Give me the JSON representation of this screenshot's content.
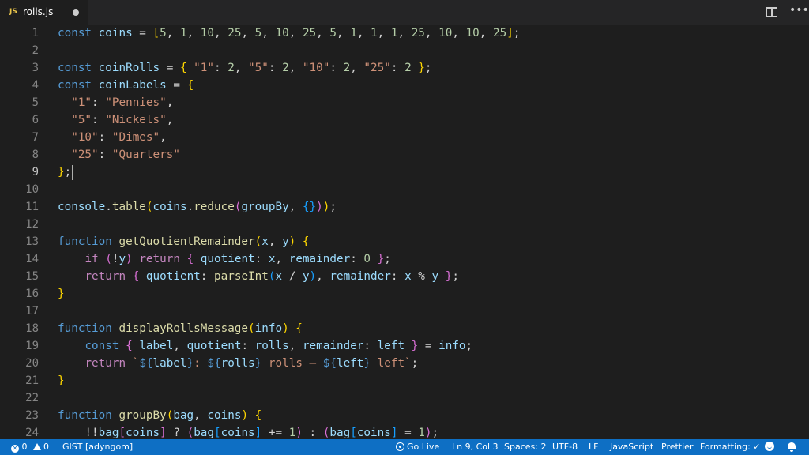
{
  "tab": {
    "badge": "JS",
    "name": "rolls.js",
    "unsaved": true
  },
  "editor": {
    "active_line": 9,
    "lines": [
      {
        "n": "1",
        "tokens": [
          [
            "kw",
            "const "
          ],
          [
            "var",
            "coins"
          ],
          [
            "p",
            " = "
          ],
          [
            "b1",
            "["
          ],
          [
            "num",
            "5"
          ],
          [
            "p",
            ", "
          ],
          [
            "num",
            "1"
          ],
          [
            "p",
            ", "
          ],
          [
            "num",
            "10"
          ],
          [
            "p",
            ", "
          ],
          [
            "num",
            "25"
          ],
          [
            "p",
            ", "
          ],
          [
            "num",
            "5"
          ],
          [
            "p",
            ", "
          ],
          [
            "num",
            "10"
          ],
          [
            "p",
            ", "
          ],
          [
            "num",
            "25"
          ],
          [
            "p",
            ", "
          ],
          [
            "num",
            "5"
          ],
          [
            "p",
            ", "
          ],
          [
            "num",
            "1"
          ],
          [
            "p",
            ", "
          ],
          [
            "num",
            "1"
          ],
          [
            "p",
            ", "
          ],
          [
            "num",
            "1"
          ],
          [
            "p",
            ", "
          ],
          [
            "num",
            "25"
          ],
          [
            "p",
            ", "
          ],
          [
            "num",
            "10"
          ],
          [
            "p",
            ", "
          ],
          [
            "num",
            "10"
          ],
          [
            "p",
            ", "
          ],
          [
            "num",
            "25"
          ],
          [
            "b1",
            "]"
          ],
          [
            "p",
            ";"
          ]
        ]
      },
      {
        "n": "2",
        "tokens": []
      },
      {
        "n": "3",
        "tokens": [
          [
            "kw",
            "const "
          ],
          [
            "var",
            "coinRolls"
          ],
          [
            "p",
            " = "
          ],
          [
            "b1",
            "{ "
          ],
          [
            "str",
            "\"1\""
          ],
          [
            "p",
            ": "
          ],
          [
            "num",
            "2"
          ],
          [
            "p",
            ", "
          ],
          [
            "str",
            "\"5\""
          ],
          [
            "p",
            ": "
          ],
          [
            "num",
            "2"
          ],
          [
            "p",
            ", "
          ],
          [
            "str",
            "\"10\""
          ],
          [
            "p",
            ": "
          ],
          [
            "num",
            "2"
          ],
          [
            "p",
            ", "
          ],
          [
            "str",
            "\"25\""
          ],
          [
            "p",
            ": "
          ],
          [
            "num",
            "2"
          ],
          [
            "b1",
            " }"
          ],
          [
            "p",
            ";"
          ]
        ]
      },
      {
        "n": "4",
        "tokens": [
          [
            "kw",
            "const "
          ],
          [
            "var",
            "coinLabels"
          ],
          [
            "p",
            " = "
          ],
          [
            "b1",
            "{"
          ]
        ]
      },
      {
        "n": "5",
        "tokens": [
          [
            "p",
            "  "
          ],
          [
            "str",
            "\"1\""
          ],
          [
            "p",
            ": "
          ],
          [
            "str",
            "\"Pennies\""
          ],
          [
            "p",
            ","
          ]
        ]
      },
      {
        "n": "6",
        "tokens": [
          [
            "p",
            "  "
          ],
          [
            "str",
            "\"5\""
          ],
          [
            "p",
            ": "
          ],
          [
            "str",
            "\"Nickels\""
          ],
          [
            "p",
            ","
          ]
        ]
      },
      {
        "n": "7",
        "tokens": [
          [
            "p",
            "  "
          ],
          [
            "str",
            "\"10\""
          ],
          [
            "p",
            ": "
          ],
          [
            "str",
            "\"Dimes\""
          ],
          [
            "p",
            ","
          ]
        ]
      },
      {
        "n": "8",
        "tokens": [
          [
            "p",
            "  "
          ],
          [
            "str",
            "\"25\""
          ],
          [
            "p",
            ": "
          ],
          [
            "str",
            "\"Quarters\""
          ]
        ]
      },
      {
        "n": "9",
        "tokens": [
          [
            "b1",
            "}"
          ],
          [
            "p",
            ";"
          ]
        ]
      },
      {
        "n": "10",
        "tokens": []
      },
      {
        "n": "11",
        "tokens": [
          [
            "var",
            "console"
          ],
          [
            "p",
            "."
          ],
          [
            "fn",
            "table"
          ],
          [
            "b1",
            "("
          ],
          [
            "var",
            "coins"
          ],
          [
            "p",
            "."
          ],
          [
            "fn",
            "reduce"
          ],
          [
            "b2",
            "("
          ],
          [
            "var",
            "groupBy"
          ],
          [
            "p",
            ", "
          ],
          [
            "b3",
            "{}"
          ],
          [
            "b2",
            ")"
          ],
          [
            "b1",
            ")"
          ],
          [
            "p",
            ";"
          ]
        ]
      },
      {
        "n": "12",
        "tokens": []
      },
      {
        "n": "13",
        "tokens": [
          [
            "kw",
            "function "
          ],
          [
            "fn",
            "getQuotientRemainder"
          ],
          [
            "b1",
            "("
          ],
          [
            "var",
            "x"
          ],
          [
            "p",
            ", "
          ],
          [
            "var",
            "y"
          ],
          [
            "b1",
            ")"
          ],
          [
            "p",
            " "
          ],
          [
            "b1",
            "{"
          ]
        ]
      },
      {
        "n": "14",
        "tokens": [
          [
            "p",
            "    "
          ],
          [
            "ctl",
            "if "
          ],
          [
            "b2",
            "("
          ],
          [
            "p",
            "!"
          ],
          [
            "var",
            "y"
          ],
          [
            "b2",
            ")"
          ],
          [
            "p",
            " "
          ],
          [
            "ctl",
            "return "
          ],
          [
            "b2",
            "{ "
          ],
          [
            "var",
            "quotient"
          ],
          [
            "p",
            ": "
          ],
          [
            "var",
            "x"
          ],
          [
            "p",
            ", "
          ],
          [
            "var",
            "remainder"
          ],
          [
            "p",
            ": "
          ],
          [
            "num",
            "0"
          ],
          [
            "b2",
            " }"
          ],
          [
            "p",
            ";"
          ]
        ]
      },
      {
        "n": "15",
        "tokens": [
          [
            "p",
            "    "
          ],
          [
            "ctl",
            "return "
          ],
          [
            "b2",
            "{ "
          ],
          [
            "var",
            "quotient"
          ],
          [
            "p",
            ": "
          ],
          [
            "fn",
            "parseInt"
          ],
          [
            "b3",
            "("
          ],
          [
            "var",
            "x"
          ],
          [
            "p",
            " / "
          ],
          [
            "var",
            "y"
          ],
          [
            "b3",
            ")"
          ],
          [
            "p",
            ", "
          ],
          [
            "var",
            "remainder"
          ],
          [
            "p",
            ": "
          ],
          [
            "var",
            "x"
          ],
          [
            "p",
            " % "
          ],
          [
            "var",
            "y"
          ],
          [
            "b2",
            " }"
          ],
          [
            "p",
            ";"
          ]
        ]
      },
      {
        "n": "16",
        "tokens": [
          [
            "b1",
            "}"
          ]
        ]
      },
      {
        "n": "17",
        "tokens": []
      },
      {
        "n": "18",
        "tokens": [
          [
            "kw",
            "function "
          ],
          [
            "fn",
            "displayRollsMessage"
          ],
          [
            "b1",
            "("
          ],
          [
            "var",
            "info"
          ],
          [
            "b1",
            ")"
          ],
          [
            "p",
            " "
          ],
          [
            "b1",
            "{"
          ]
        ]
      },
      {
        "n": "19",
        "tokens": [
          [
            "p",
            "    "
          ],
          [
            "kw",
            "const "
          ],
          [
            "b2",
            "{ "
          ],
          [
            "var",
            "label"
          ],
          [
            "p",
            ", "
          ],
          [
            "var",
            "quotient"
          ],
          [
            "p",
            ": "
          ],
          [
            "var",
            "rolls"
          ],
          [
            "p",
            ", "
          ],
          [
            "var",
            "remainder"
          ],
          [
            "p",
            ": "
          ],
          [
            "var",
            "left"
          ],
          [
            "b2",
            " }"
          ],
          [
            "p",
            " = "
          ],
          [
            "var",
            "info"
          ],
          [
            "p",
            ";"
          ]
        ]
      },
      {
        "n": "20",
        "tokens": [
          [
            "p",
            "    "
          ],
          [
            "ctl",
            "return "
          ],
          [
            "str",
            "`"
          ],
          [
            "kw",
            "${"
          ],
          [
            "var",
            "label"
          ],
          [
            "kw",
            "}"
          ],
          [
            "str",
            ": "
          ],
          [
            "kw",
            "${"
          ],
          [
            "var",
            "rolls"
          ],
          [
            "kw",
            "}"
          ],
          [
            "str",
            " rolls – "
          ],
          [
            "kw",
            "${"
          ],
          [
            "var",
            "left"
          ],
          [
            "kw",
            "}"
          ],
          [
            "str",
            " left`"
          ],
          [
            "p",
            ";"
          ]
        ]
      },
      {
        "n": "21",
        "tokens": [
          [
            "b1",
            "}"
          ]
        ]
      },
      {
        "n": "22",
        "tokens": []
      },
      {
        "n": "23",
        "tokens": [
          [
            "kw",
            "function "
          ],
          [
            "fn",
            "groupBy"
          ],
          [
            "b1",
            "("
          ],
          [
            "var",
            "bag"
          ],
          [
            "p",
            ", "
          ],
          [
            "var",
            "coins"
          ],
          [
            "b1",
            ")"
          ],
          [
            "p",
            " "
          ],
          [
            "b1",
            "{"
          ]
        ]
      },
      {
        "n": "24",
        "tokens": [
          [
            "p",
            "    !!"
          ],
          [
            "var",
            "bag"
          ],
          [
            "b2",
            "["
          ],
          [
            "var",
            "coins"
          ],
          [
            "b2",
            "]"
          ],
          [
            "p",
            " ? "
          ],
          [
            "b2",
            "("
          ],
          [
            "var",
            "bag"
          ],
          [
            "b3",
            "["
          ],
          [
            "var",
            "coins"
          ],
          [
            "b3",
            "]"
          ],
          [
            "p",
            " += "
          ],
          [
            "num",
            "1"
          ],
          [
            "b2",
            ")"
          ],
          [
            "p",
            " : "
          ],
          [
            "b2",
            "("
          ],
          [
            "var",
            "bag"
          ],
          [
            "b3",
            "["
          ],
          [
            "var",
            "coins"
          ],
          [
            "b3",
            "]"
          ],
          [
            "p",
            " = "
          ],
          [
            "num",
            "1"
          ],
          [
            "b2",
            ")"
          ],
          [
            "p",
            ";"
          ]
        ]
      }
    ]
  },
  "status": {
    "errors": "0",
    "warnings": "0",
    "gist": "GIST [adyngom]",
    "go_live": "Go Live",
    "position": "Ln 9, Col 3",
    "spaces": "Spaces: 2",
    "encoding": "UTF-8",
    "eol": "LF",
    "language": "JavaScript",
    "prettier": "Prettier",
    "formatting": "Formatting: ✓"
  },
  "icons": {
    "split": "split-editor-icon",
    "more": "more-actions-icon",
    "feedback": "smiley-icon",
    "notifications": "bell-icon"
  },
  "colors": {
    "statusbar": "#0e6fc4",
    "keyword": "#569cd6",
    "function": "#dcdcaa",
    "string": "#ce9178",
    "number": "#b5cea8",
    "control": "#c586c0"
  }
}
